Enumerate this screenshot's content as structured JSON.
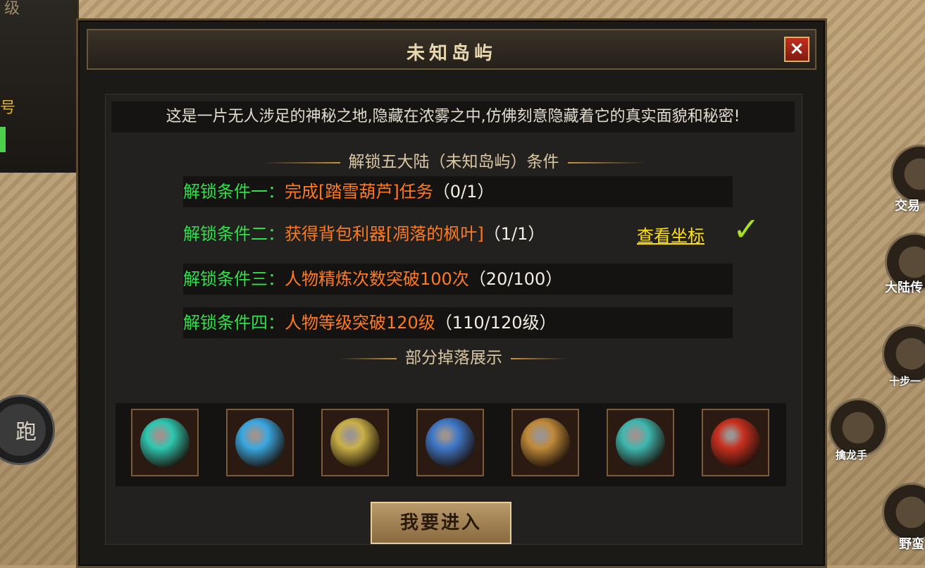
{
  "hud": {
    "level_char": "级",
    "acc_char": "号",
    "run_button": "跑",
    "right_labels": [
      "交易",
      "大陆传",
      "十步一",
      "擒龙手",
      "野蛮"
    ]
  },
  "dialog": {
    "title": "未知岛屿",
    "close": "×",
    "description": "这是一片无人涉足的神秘之地,隐藏在浓雾之中,仿佛刻意隐藏着它的真实面貌和秘密!",
    "unlock_title": "解锁五大陆（未知岛屿）条件",
    "conditions": [
      {
        "label": "解锁条件一：",
        "text": "完成[踏雪葫芦]任务",
        "progress": "（0/1）"
      },
      {
        "label": "解锁条件二：",
        "text": "获得背包利器[凋落的枫叶]",
        "progress": "（1/1）",
        "link": "查看坐标",
        "done": true
      },
      {
        "label": "解锁条件三：",
        "text": "人物精炼次数突破100次",
        "progress": "（20/100）"
      },
      {
        "label": "解锁条件四：",
        "text": "人物等级突破120级",
        "progress": "（110/120级）"
      }
    ],
    "check_mark": "✓",
    "drops_title": "部分掉落展示",
    "drop_items": [
      {
        "icon": "jade-gourd-icon",
        "color": "#2fc7b0"
      },
      {
        "icon": "blue-armor-icon",
        "color": "#3aa8e0"
      },
      {
        "icon": "golden-dragon-icon",
        "color": "#c9b048"
      },
      {
        "icon": "blue-wing-icon",
        "color": "#3f78c8"
      },
      {
        "icon": "jade-ring-icon",
        "color": "#c08a3a"
      },
      {
        "icon": "jade-vase-icon",
        "color": "#3fb8b0"
      },
      {
        "icon": "red-jar-icon",
        "color": "#c83020"
      }
    ],
    "enter_button": "我要进入"
  }
}
